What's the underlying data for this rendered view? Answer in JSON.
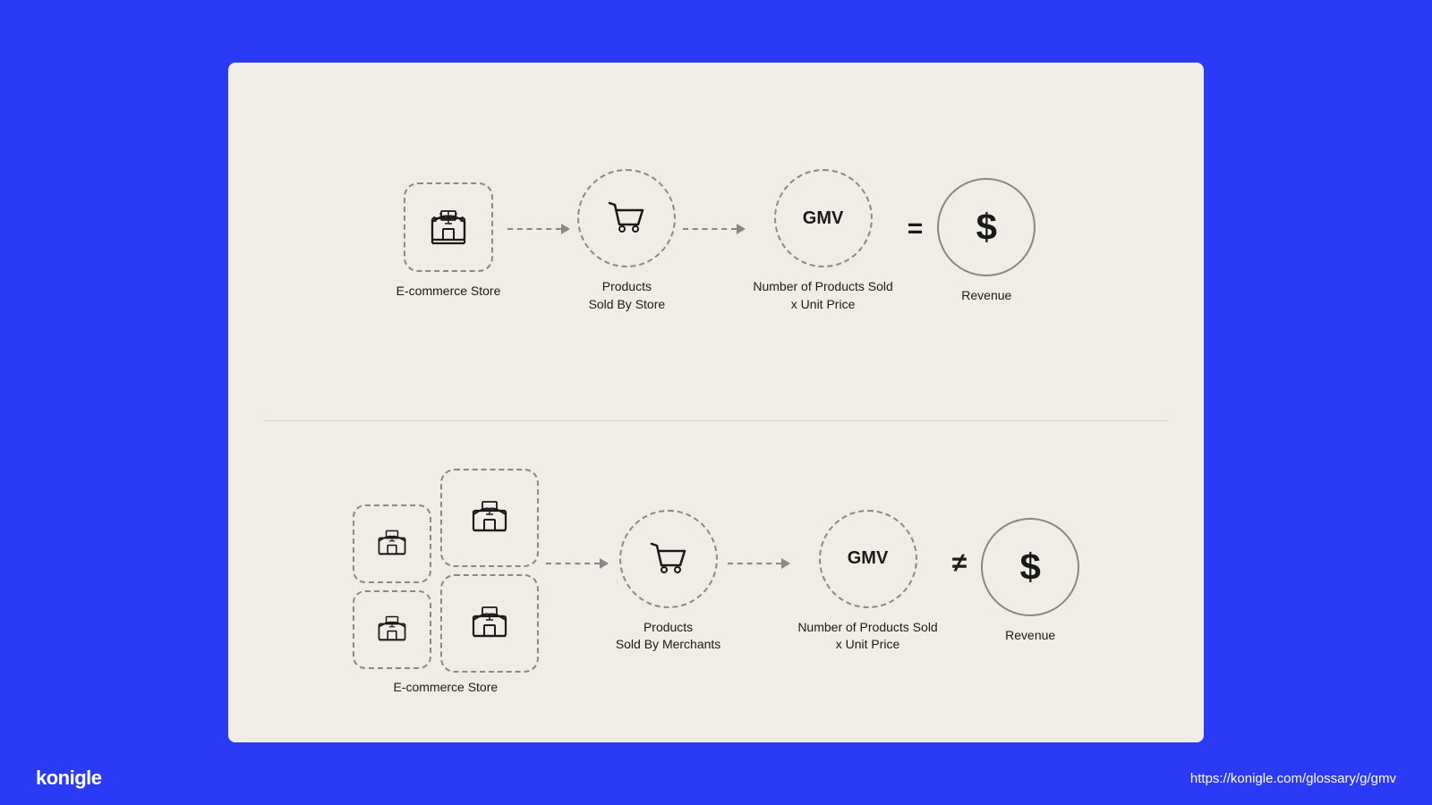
{
  "brand": "konigle",
  "url": "https://konigle.com/glossary/g/gmv",
  "top_flow": {
    "store_label": "E-commerce Store",
    "products_label": "Products\nSold By Store",
    "gmv_label": "GMV",
    "equation_label": "Number of Products Sold\nx Unit Price",
    "revenue_label": "Revenue",
    "equals": "="
  },
  "bottom_flow": {
    "store_label": "E-commerce Store",
    "products_label": "Products\nSold By Merchants",
    "gmv_label": "GMV",
    "equation_label": "Number of Products Sold\nx Unit Price",
    "revenue_label": "Revenue",
    "not_equals": "≠"
  }
}
